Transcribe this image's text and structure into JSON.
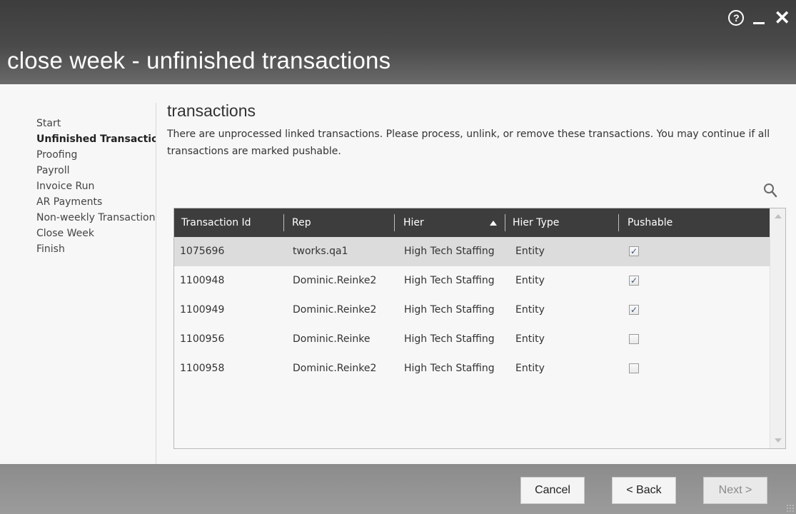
{
  "window": {
    "title": "close week - unfinished transactions",
    "controls": {
      "help": "?"
    }
  },
  "sidebar": {
    "items": [
      {
        "label": "Start",
        "active": false
      },
      {
        "label": "Unfinished Transactions",
        "active": true
      },
      {
        "label": "Proofing",
        "active": false
      },
      {
        "label": "Payroll",
        "active": false
      },
      {
        "label": "Invoice Run",
        "active": false
      },
      {
        "label": "AR Payments",
        "active": false
      },
      {
        "label": "Non-weekly Transactions",
        "active": false
      },
      {
        "label": "Close Week",
        "active": false
      },
      {
        "label": "Finish",
        "active": false
      }
    ]
  },
  "main": {
    "section_title": "transactions",
    "description": "There are unprocessed linked transactions. Please process, unlink, or remove these transactions. You may continue if all transactions are marked pushable.",
    "grid": {
      "columns": [
        "Transaction Id",
        "Rep",
        "Hier",
        "Hier Type",
        "Pushable"
      ],
      "sort": {
        "column": "Hier",
        "direction": "asc"
      },
      "rows": [
        {
          "id": "1075696",
          "rep": "tworks.qa1",
          "hier": "High Tech Staffing",
          "hier_type": "Entity",
          "pushable": true,
          "selected": true
        },
        {
          "id": "1100948",
          "rep": "Dominic.Reinke2",
          "hier": "High Tech Staffing",
          "hier_type": "Entity",
          "pushable": true,
          "selected": false
        },
        {
          "id": "1100949",
          "rep": "Dominic.Reinke2",
          "hier": "High Tech Staffing",
          "hier_type": "Entity",
          "pushable": true,
          "selected": false
        },
        {
          "id": "1100956",
          "rep": "Dominic.Reinke",
          "hier": "High Tech Staffing",
          "hier_type": "Entity",
          "pushable": false,
          "selected": false
        },
        {
          "id": "1100958",
          "rep": "Dominic.Reinke2",
          "hier": "High Tech Staffing",
          "hier_type": "Entity",
          "pushable": false,
          "selected": false
        }
      ]
    }
  },
  "footer": {
    "cancel_label": "Cancel",
    "back_label": "< Back",
    "next_label": "Next >",
    "next_enabled": false
  },
  "icons": {
    "help": "help-icon",
    "minimize": "minimize-icon",
    "close": "close-icon",
    "search": "search-icon",
    "checkmark": "checkmark-icon"
  },
  "colors": {
    "titlebar": "#3d3d3d",
    "grid_header": "#3d3d3d",
    "selected_row": "#dcdcdc",
    "footer": "#8c8c8c"
  }
}
